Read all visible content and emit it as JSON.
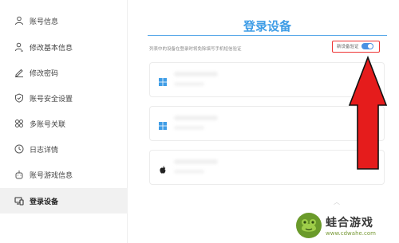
{
  "sidebar": {
    "items": [
      {
        "label": "账号信息",
        "icon": "user-icon"
      },
      {
        "label": "修改基本信息",
        "icon": "user-edit-icon"
      },
      {
        "label": "修改密码",
        "icon": "pen-icon"
      },
      {
        "label": "账号安全设置",
        "icon": "shield-icon"
      },
      {
        "label": "多账号关联",
        "icon": "link-accounts-icon"
      },
      {
        "label": "日志详情",
        "icon": "clock-icon"
      },
      {
        "label": "账号游戏信息",
        "icon": "gamepad-icon"
      },
      {
        "label": "登录设备",
        "icon": "devices-icon"
      }
    ],
    "active_index": 7
  },
  "main": {
    "title": "登录设备",
    "hint": "列表中的设备在登录时将免除填写手机短信验证",
    "toggle": {
      "label": "新设备验证",
      "on": true
    },
    "devices": [
      {
        "icon": "windows-icon"
      },
      {
        "icon": "windows-icon"
      },
      {
        "icon": "apple-icon"
      }
    ]
  },
  "watermark": {
    "name": "蛙合游戏",
    "url": "www.cdwahe.com"
  },
  "colors": {
    "accent": "#3f9de6",
    "toggle": "#4a90e2",
    "arrow": "#e51c1c",
    "active_bg": "#f1f1f1"
  }
}
